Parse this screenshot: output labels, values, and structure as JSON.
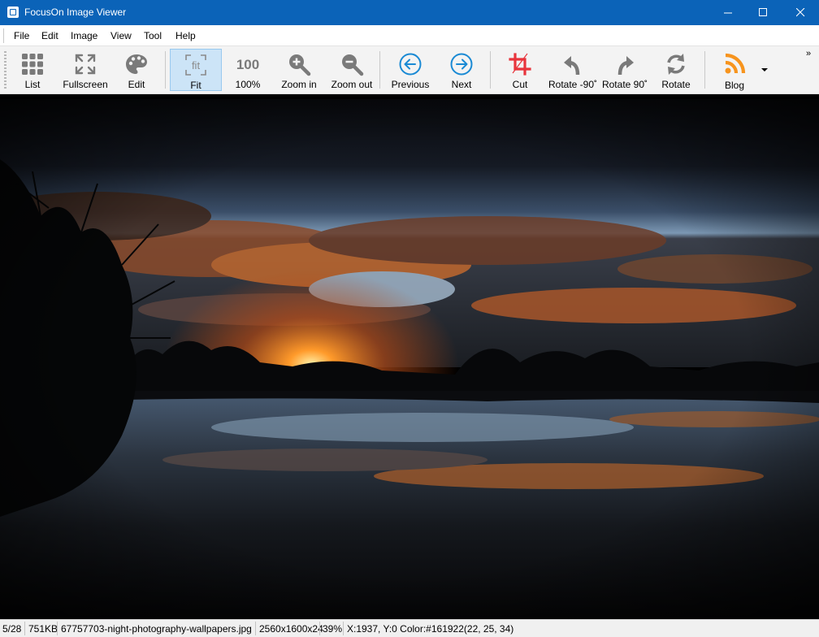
{
  "window": {
    "title": "FocusOn Image Viewer",
    "controls": {
      "minimize": "—",
      "maximize": "☐",
      "close": "✕"
    }
  },
  "menu": [
    "File",
    "Edit",
    "Image",
    "View",
    "Tool",
    "Help"
  ],
  "toolbar": {
    "buttons": [
      {
        "label": "List",
        "icon": "grid-icon"
      },
      {
        "label": "Fullscreen",
        "icon": "fullscreen-icon"
      },
      {
        "label": "Edit",
        "icon": "palette-icon"
      },
      {
        "label": "Fit",
        "icon": "fit-icon",
        "active": true
      },
      {
        "label": "100%",
        "icon": "actual-size-icon",
        "icon_text": "100"
      },
      {
        "label": "Zoom in",
        "icon": "zoom-in-icon"
      },
      {
        "label": "Zoom out",
        "icon": "zoom-out-icon"
      },
      {
        "label": "Previous",
        "icon": "arrow-left-icon"
      },
      {
        "label": "Next",
        "icon": "arrow-right-icon"
      },
      {
        "label": "Cut",
        "icon": "crop-icon"
      },
      {
        "label": "Rotate -90˚",
        "icon": "rotate-left-icon"
      },
      {
        "label": "Rotate 90˚",
        "icon": "rotate-right-icon"
      },
      {
        "label": "Rotate",
        "icon": "rotate-icon"
      },
      {
        "label": "Blog",
        "icon": "rss-icon"
      }
    ],
    "fit_icon_text": "fit",
    "overflow": "»"
  },
  "colors": {
    "titlebar": "#0b63b8",
    "accent_blue": "#1a8ad4",
    "crop_red": "#e8343c",
    "rss_orange": "#f7941d",
    "icon_gray": "#7a7a7a"
  },
  "status": {
    "index": "5/28",
    "size": "751KB",
    "filename": "67757703-night-photography-wallpapers.jpg",
    "dimensions": "2560x1600x24",
    "zoom": "39%",
    "pixel_info": "X:1937, Y:0 Color:#161922(22, 25, 34)"
  }
}
